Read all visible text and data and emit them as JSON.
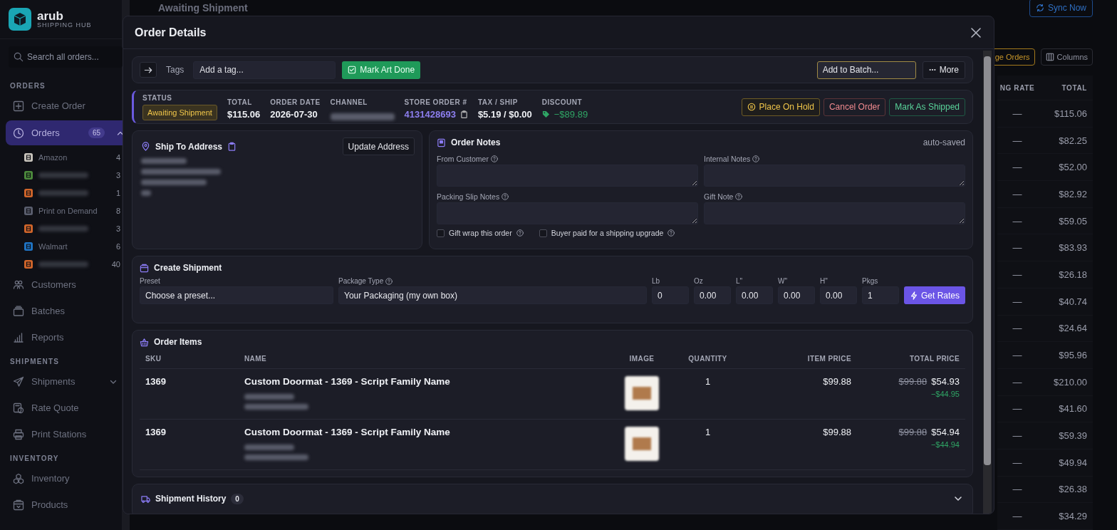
{
  "sidebar": {
    "brand": "arub",
    "brand_sub": "SHIPPING HUB",
    "search": {
      "placeholder": "Search all orders..."
    },
    "sections": [
      {
        "heading": "ORDERS",
        "items": [
          {
            "label": "Create Order",
            "selected": false
          },
          {
            "label": "Orders",
            "selected": true,
            "badge": "65",
            "expanded": true,
            "children": [
              {
                "label": "Amazon",
                "count": "4",
                "color": "#c8c4bc"
              },
              {
                "redacted": true,
                "count": "3",
                "color": "#4c8a3c"
              },
              {
                "redacted": true,
                "count": "1",
                "color": "#d0652a"
              },
              {
                "label": "Print on Demand",
                "count": "8",
                "color": "#5a5e6e"
              },
              {
                "redacted": true,
                "count": "3",
                "color": "#d0652a"
              },
              {
                "label": "Walmart",
                "count": "6",
                "color": "#1f74c4"
              },
              {
                "redacted": true,
                "count": "40",
                "color": "#d0652a"
              }
            ]
          },
          {
            "label": "Customers",
            "selected": false
          },
          {
            "label": "Batches",
            "selected": false
          },
          {
            "label": "Reports",
            "selected": false
          }
        ]
      },
      {
        "heading": "SHIPMENTS",
        "items": [
          {
            "label": "Shipments",
            "selected": false,
            "expanded": false
          },
          {
            "label": "Rate Quote",
            "selected": false
          },
          {
            "label": "Print Stations",
            "selected": false
          }
        ]
      },
      {
        "heading": "INVENTORY",
        "items": [
          {
            "label": "Inventory",
            "selected": false
          },
          {
            "label": "Products",
            "selected": false
          }
        ]
      }
    ]
  },
  "main": {
    "title": "Awaiting Shipment",
    "sync_button": "Sync Now",
    "toolbar": [
      "ge Orders",
      "Columns"
    ],
    "table": {
      "columns": [
        "NG RATE",
        "TOTAL"
      ],
      "rows": [
        {
          "rate": "—",
          "total": "$115.06"
        },
        {
          "rate": "—",
          "total": "$82.25"
        },
        {
          "rate": "—",
          "total": "$52.00"
        },
        {
          "rate": "—",
          "total": "$82.92"
        },
        {
          "rate": "—",
          "total": "$59.05"
        },
        {
          "rate": "—",
          "total": "$83.93"
        },
        {
          "rate": "—",
          "total": "$26.18"
        },
        {
          "rate": "—",
          "total": "$40.74"
        },
        {
          "rate": "—",
          "total": "$24.64"
        },
        {
          "rate": "—",
          "total": "$95.96"
        },
        {
          "rate": "—",
          "total": "$210.00"
        },
        {
          "rate": "—",
          "total": "$41.60"
        },
        {
          "rate": "—",
          "total": "$59.39"
        },
        {
          "rate": "—",
          "total": "$49.94"
        },
        {
          "rate": "—",
          "total": "$26.38"
        },
        {
          "rate": "—",
          "total": "$34.29"
        }
      ]
    }
  },
  "order_modal": {
    "title": "Order Details",
    "toolbar": {
      "tags_label": "Tags",
      "tag_input": {
        "placeholder": "Add a tag..."
      },
      "mark_art_done": "Mark Art Done",
      "batch_select": {
        "placeholder": "Add to Batch..."
      },
      "more": "More"
    },
    "summary": {
      "status": {
        "label": "STATUS",
        "value": "Awaiting Shipment"
      },
      "fields": [
        {
          "label": "TOTAL",
          "value": "$115.06",
          "kind": "plain"
        },
        {
          "label": "ORDER DATE",
          "value": "2026-07-30",
          "kind": "plain"
        },
        {
          "label": "CHANNEL",
          "kind": "redacted"
        },
        {
          "label": "STORE ORDER #",
          "value": "4131428693",
          "kind": "link"
        },
        {
          "label": "TAX / SHIP",
          "value": "$5.19 / $0.00",
          "kind": "plain"
        },
        {
          "label": "DISCOUNT",
          "value": "−$89.89",
          "kind": "discount"
        }
      ],
      "actions": [
        {
          "label": "Place On Hold",
          "kind": "hold"
        },
        {
          "label": "Cancel Order",
          "kind": "cancel"
        },
        {
          "label": "Mark As Shipped",
          "kind": "ship"
        }
      ]
    },
    "ship_to": {
      "title": "Ship To Address",
      "button": "Update Address"
    },
    "notes": {
      "title": "Order Notes",
      "status": "auto-saved",
      "fields": [
        {
          "label": "From Customer"
        },
        {
          "label": "Internal Notes"
        },
        {
          "label": "Packing Slip Notes"
        },
        {
          "label": "Gift Note"
        }
      ],
      "options": [
        {
          "label": "Gift wrap this order",
          "checked": false
        },
        {
          "label": "Buyer paid for a shipping upgrade",
          "checked": false
        }
      ]
    },
    "shipment": {
      "title": "Create Shipment",
      "preset": {
        "label": "Preset",
        "value": "Choose a preset..."
      },
      "package": {
        "label": "Package Type",
        "value": "Your Packaging (my own box)"
      },
      "dims": [
        {
          "label": "Lb",
          "value": "0"
        },
        {
          "label": "Oz",
          "value": "0.00"
        },
        {
          "label": "L\"",
          "value": "0.00"
        },
        {
          "label": "W\"",
          "value": "0.00"
        },
        {
          "label": "H\"",
          "value": "0.00"
        },
        {
          "label": "Pkgs",
          "value": "1"
        }
      ],
      "button": "Get Rates"
    },
    "items": {
      "title": "Order Items",
      "columns": [
        "SKU",
        "NAME",
        "IMAGE",
        "QUANTITY",
        "ITEM PRICE",
        "TOTAL PRICE"
      ],
      "rows": [
        {
          "sku": "1369",
          "name": "Custom Doormat - 1369 - Script Family Name",
          "quantity": "1",
          "item_price": "$99.88",
          "original_price": "$99.88",
          "total_price": "$54.93",
          "discount": "−$44.95"
        },
        {
          "sku": "1369",
          "name": "Custom Doormat - 1369 - Script Family Name",
          "quantity": "1",
          "item_price": "$99.88",
          "original_price": "$99.88",
          "total_price": "$54.94",
          "discount": "−$44.94"
        }
      ]
    },
    "history": {
      "title": "Shipment History",
      "count": "0",
      "expanded": false
    }
  }
}
